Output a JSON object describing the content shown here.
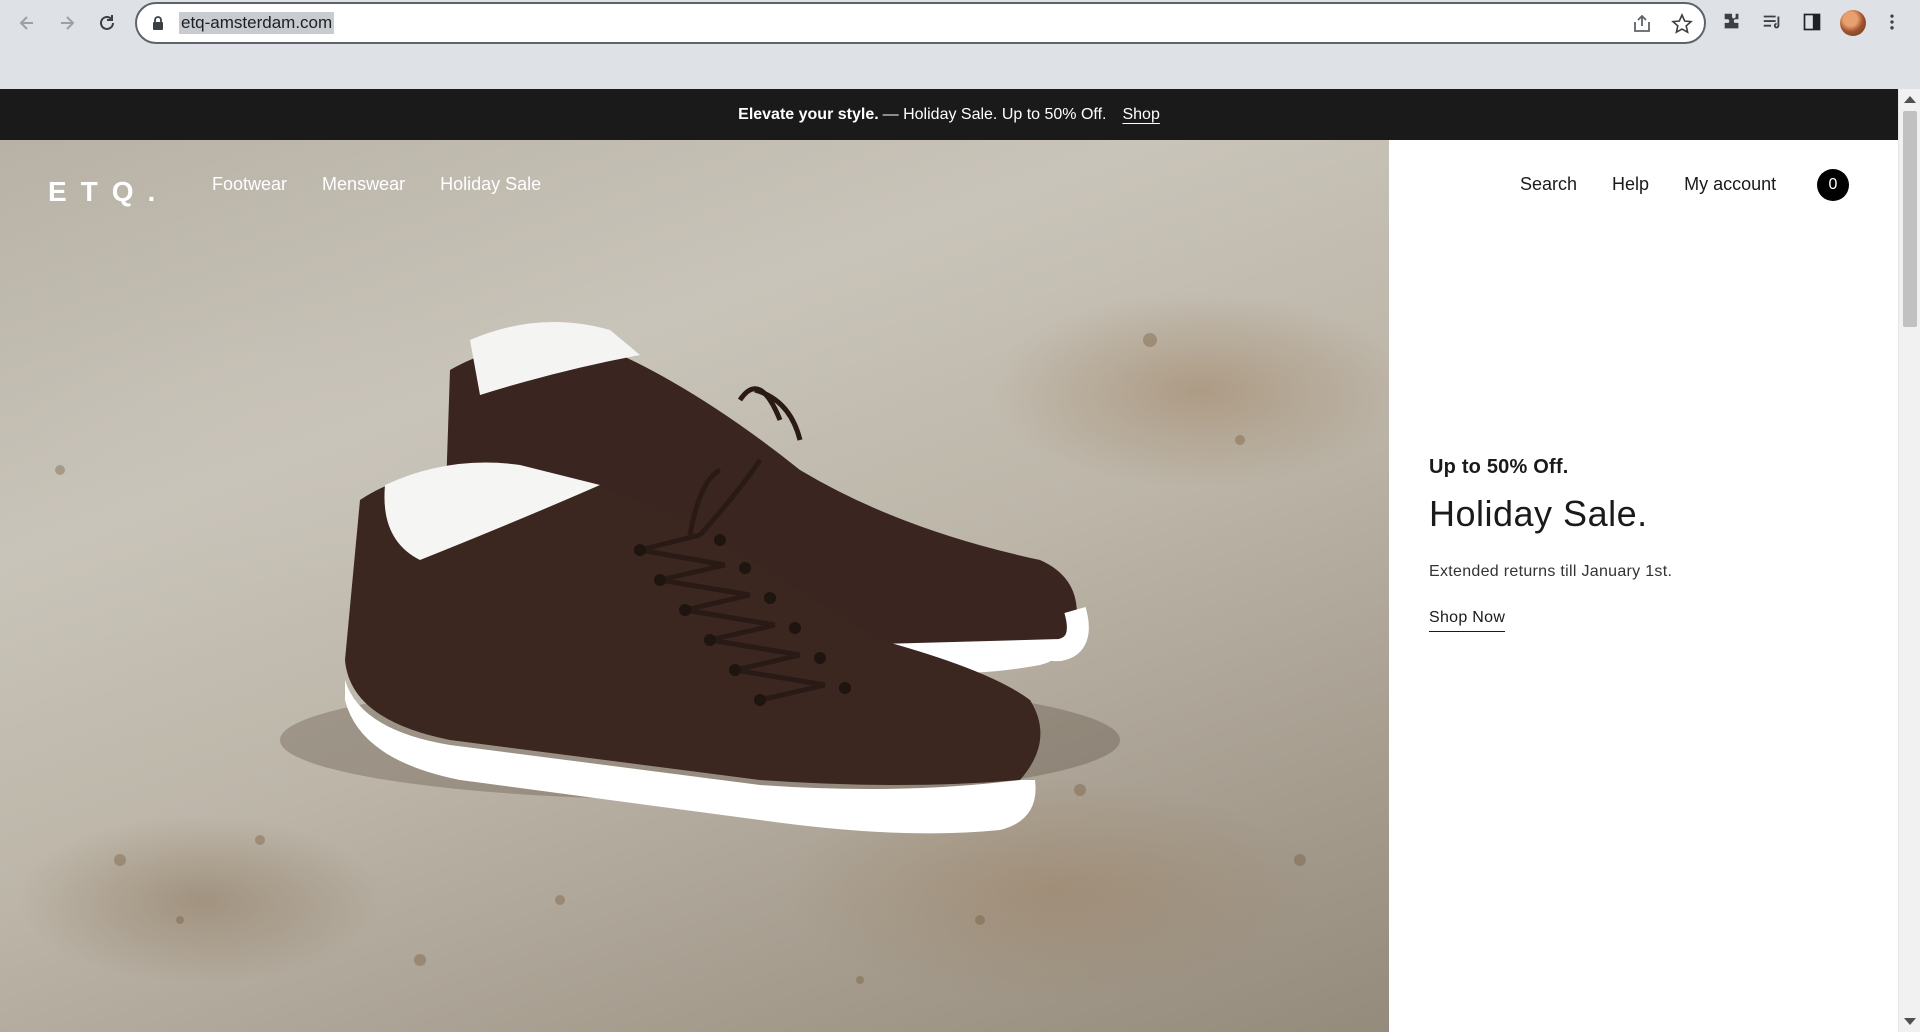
{
  "browser": {
    "url": "etq-amsterdam.com",
    "icons": [
      "back-arrow-icon",
      "forward-arrow-icon",
      "reload-icon",
      "lock-icon",
      "share-icon",
      "star-icon",
      "puzzle-icon",
      "media-icon",
      "side-panel-icon",
      "avatar",
      "kebab-menu-icon"
    ]
  },
  "promo": {
    "bold": "Elevate your style.",
    "text": "— Holiday Sale. Up to 50% Off.",
    "link": "Shop"
  },
  "header": {
    "logo": "ETQ.",
    "nav": [
      "Footwear",
      "Menswear",
      "Holiday Sale"
    ],
    "util": [
      "Search",
      "Help",
      "My account"
    ],
    "cart_count": "0"
  },
  "hero_panel": {
    "kicker": "Up to 50% Off.",
    "title": "Holiday Sale.",
    "body": "Extended returns till January 1st.",
    "cta": "Shop Now"
  },
  "colors": {
    "promo_bg": "#1a1a1a",
    "chrome_bg": "#dee1e6",
    "shoe": "#3b2620",
    "sole": "#ffffff"
  }
}
